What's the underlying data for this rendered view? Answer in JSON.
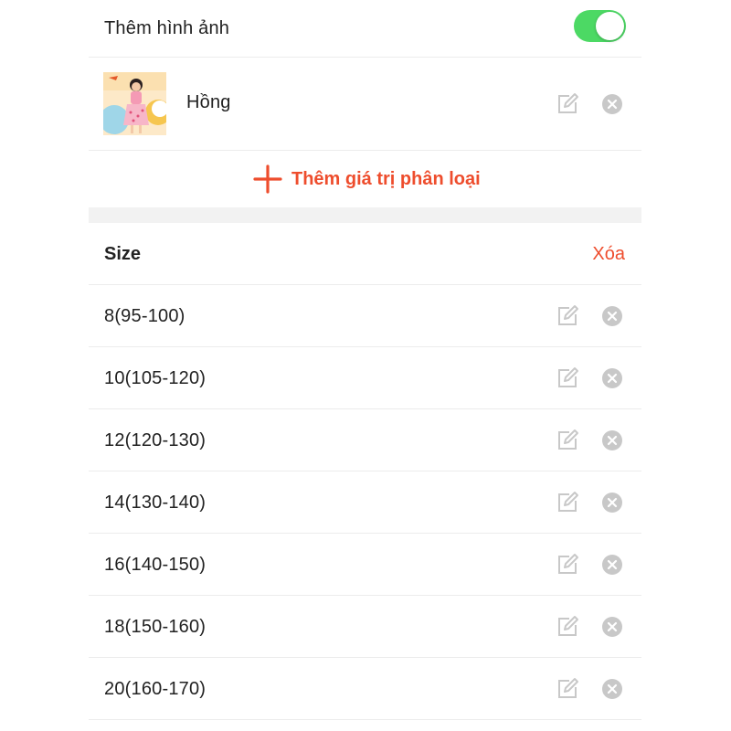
{
  "colors": {
    "accent_red": "#ee4d2d",
    "toggle_green": "#4cd964",
    "icon_gray": "#c8c8c8",
    "divider": "#ececec"
  },
  "image_toggle": {
    "label": "Thêm hình ảnh",
    "on": true
  },
  "variant": {
    "name": "Hồng",
    "edit_icon": "edit-icon",
    "remove_icon": "remove-circle-icon"
  },
  "add_value": {
    "icon": "plus-icon",
    "label": "Thêm giá trị phân loại"
  },
  "size_section": {
    "title": "Size",
    "delete_label": "Xóa",
    "items": [
      {
        "label": "8(95-100)"
      },
      {
        "label": "10(105-120)"
      },
      {
        "label": "12(120-130)"
      },
      {
        "label": "14(130-140)"
      },
      {
        "label": "16(140-150)"
      },
      {
        "label": "18(150-160)"
      },
      {
        "label": "20(160-170)"
      }
    ]
  }
}
